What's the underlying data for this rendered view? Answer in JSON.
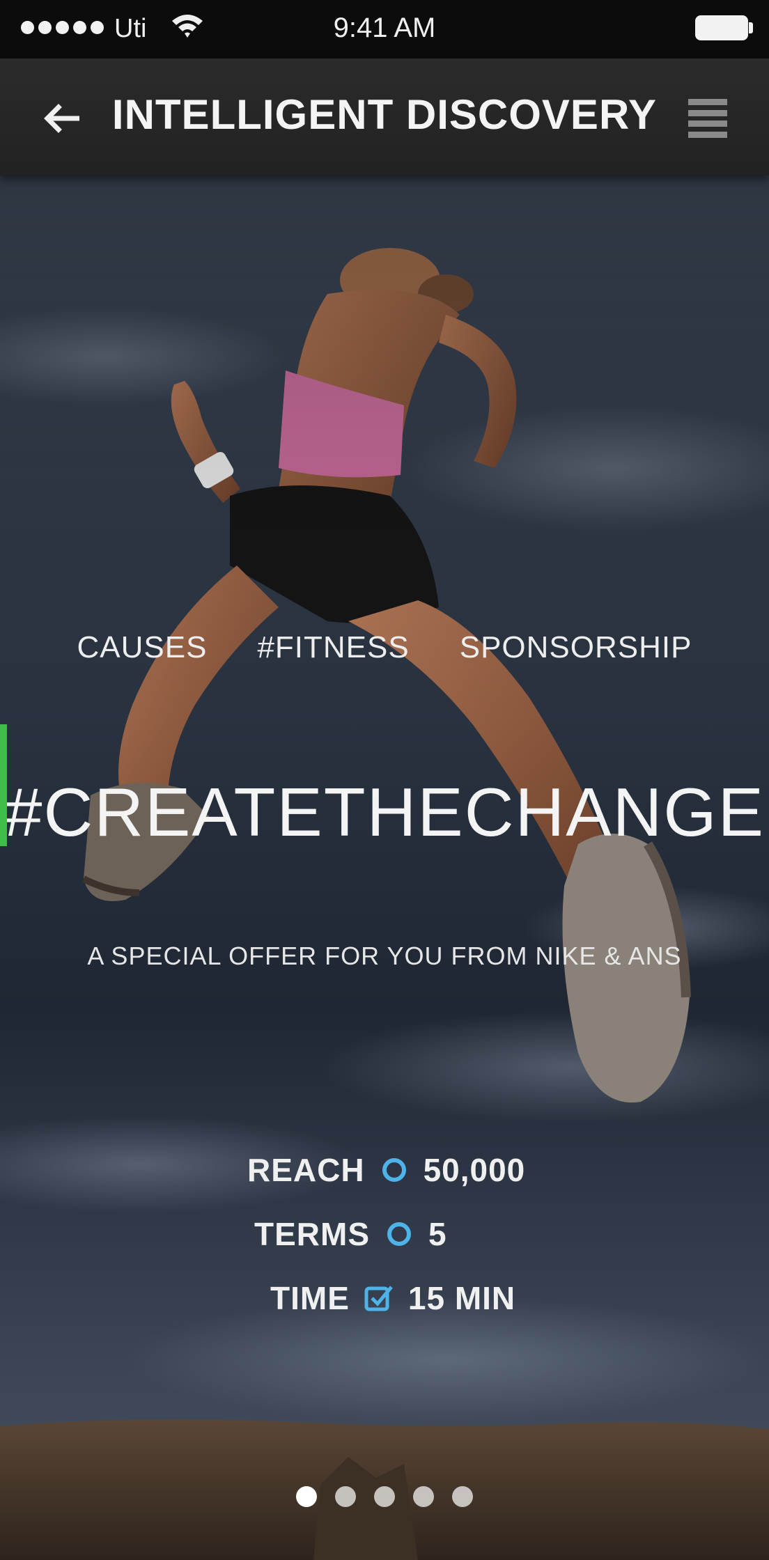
{
  "status_bar": {
    "carrier": "Uti",
    "time": "9:41 AM",
    "signal_icon": "signal-dots-icon",
    "wifi_icon": "wifi-icon",
    "battery_icon": "battery-icon"
  },
  "nav": {
    "title": "INTELLIGENT DISCOVERY",
    "back_icon": "back-arrow-icon",
    "menu_icon": "hamburger-menu-icon"
  },
  "hero": {
    "tags": [
      "CAUSES",
      "#FITNESS",
      "SPONSORSHIP"
    ],
    "headline": "#CREATETHECHANGE",
    "subline": "A SPECIAL OFFER FOR YOU FROM NIKE & ANS",
    "image_subject": "runner-jumping-against-sky"
  },
  "stats": [
    {
      "label": "REACH",
      "value": "50,000",
      "icon": "target-icon"
    },
    {
      "label": "TERMS",
      "value": "5",
      "icon": "target-icon"
    },
    {
      "label": "TIME",
      "value": "15 MIN",
      "icon": "checkbox-icon"
    }
  ],
  "pagination": {
    "count": 5,
    "active_index": 0
  },
  "colors": {
    "accent": "#4fb3e8",
    "left_indicator": "#3fbf4a",
    "status_bar_bg": "#0c0c0c",
    "nav_bg": "#262626"
  }
}
